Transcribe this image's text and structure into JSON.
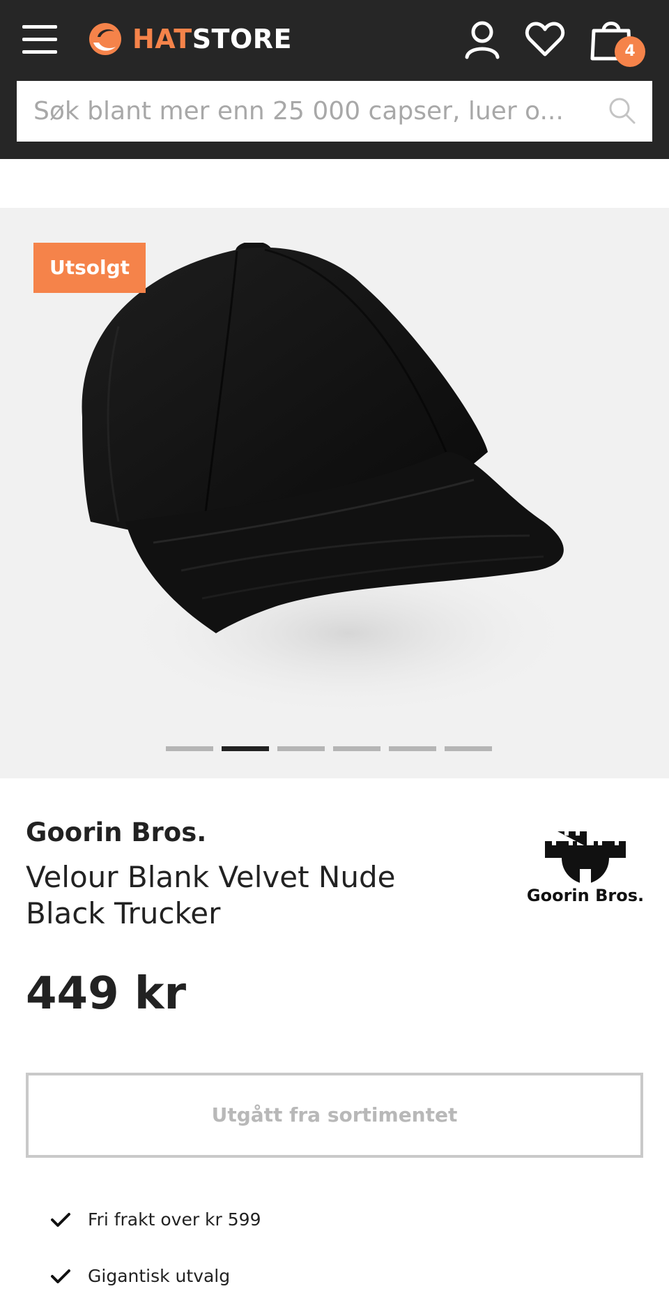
{
  "header": {
    "logo": {
      "part1": "HAT",
      "part2": "STORE"
    },
    "cart_count": "4"
  },
  "search": {
    "placeholder": "Søk blant mer enn 25 000 capser, luer o..."
  },
  "gallery": {
    "badge": "Utsolgt",
    "slide_count": 6,
    "active_slide_index": 1
  },
  "product": {
    "brand": "Goorin Bros.",
    "name": "Velour Blank Velvet Nude Black Trucker",
    "price": "449 kr",
    "brand_logo_text": "Goorin Bros.",
    "status_button": "Utgått fra sortimentet"
  },
  "usps": [
    {
      "text": "Fri frakt over kr 599"
    },
    {
      "text": "Gigantisk utvalg"
    }
  ],
  "colors": {
    "header_bg": "#262626",
    "accent": "#f5834a",
    "gallery_bg": "#f1f1f1",
    "disabled_border": "#c9c9c9"
  }
}
